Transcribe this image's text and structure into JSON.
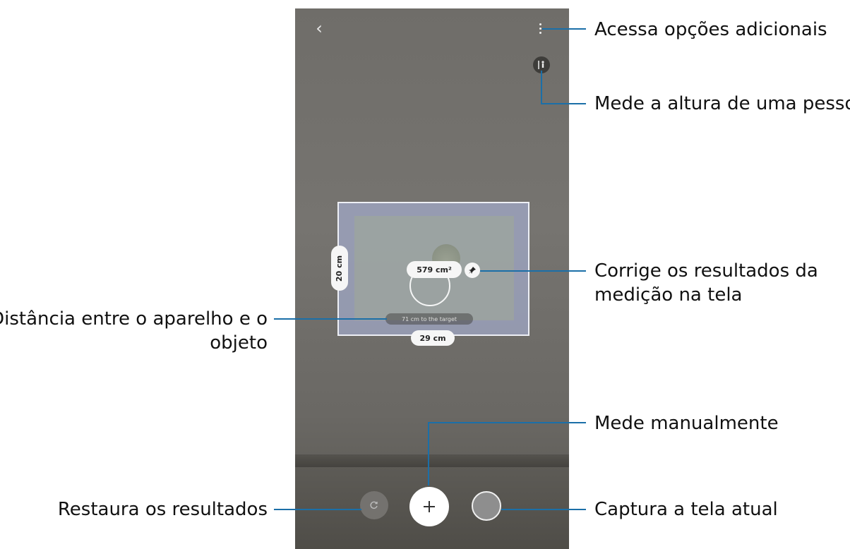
{
  "screen": {
    "area_label": "579 cm²",
    "height_label": "20 cm",
    "width_label": "29 cm",
    "distance_label": "71 cm to the target"
  },
  "callouts": {
    "more_options": "Acessa opções adicionais",
    "measure_height": "Mede a altura de uma pessoa",
    "correct_results_line1": "Corrige os resultados da",
    "correct_results_line2": "medição na tela",
    "distance_line1": "Distância entre o aparelho e o",
    "distance_line2": "objeto",
    "measure_manual": "Mede manualmente",
    "reset_results": "Restaura os resultados",
    "capture_screen": "Captura a tela atual"
  },
  "icons": {
    "back": "chevron-left-icon",
    "more": "more-vertical-icon",
    "height": "person-height-icon",
    "pin": "pin-icon",
    "reset": "reset-icon",
    "add": "plus-icon",
    "capture": "capture-icon"
  },
  "colors": {
    "callout_line": "#1b6fa8"
  }
}
